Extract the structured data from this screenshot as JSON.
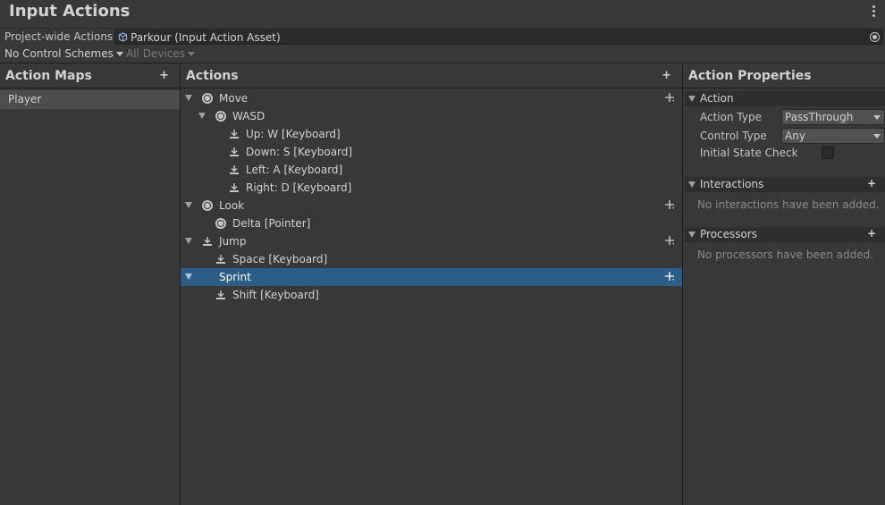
{
  "window": {
    "title": "Input Actions"
  },
  "asset": {
    "label": "Project-wide Actions",
    "value": "Parkour (Input Action Asset)"
  },
  "toolbar": {
    "scheme": "No Control Schemes",
    "devices": "All Devices"
  },
  "maps_panel": {
    "title": "Action Maps",
    "add": "+",
    "items": [
      {
        "label": "Player",
        "selected": true
      }
    ]
  },
  "actions_panel": {
    "title": "Actions",
    "add": "+",
    "rows": [
      {
        "label": "Move",
        "kind": "action",
        "icon": "value-action-icon"
      },
      {
        "label": "WASD",
        "kind": "composite",
        "icon": "value-action-icon"
      },
      {
        "label": "Up: W [Keyboard]",
        "kind": "part",
        "icon": "binding-icon"
      },
      {
        "label": "Down: S [Keyboard]",
        "kind": "part",
        "icon": "binding-icon"
      },
      {
        "label": "Left: A [Keyboard]",
        "kind": "part",
        "icon": "binding-icon"
      },
      {
        "label": "Right: D [Keyboard]",
        "kind": "part",
        "icon": "binding-icon"
      },
      {
        "label": "Look",
        "kind": "action",
        "icon": "value-action-icon"
      },
      {
        "label": "Delta [Pointer]",
        "kind": "binding",
        "icon": "value-action-icon"
      },
      {
        "label": "Jump",
        "kind": "action",
        "icon": "button-action-icon"
      },
      {
        "label": "Space [Keyboard]",
        "kind": "binding",
        "icon": "binding-icon"
      },
      {
        "label": "Sprint",
        "kind": "action",
        "icon": "none",
        "selected": true
      },
      {
        "label": "Shift [Keyboard]",
        "kind": "binding",
        "icon": "binding-icon"
      }
    ]
  },
  "properties_panel": {
    "title": "Action Properties",
    "action_section": "Action",
    "action_type_label": "Action Type",
    "action_type_value": "PassThrough",
    "control_type_label": "Control Type",
    "control_type_value": "Any",
    "initial_state_label": "Initial State Check",
    "initial_state_checked": false,
    "interactions_section": "Interactions",
    "interactions_empty": "No interactions have been added.",
    "processors_section": "Processors",
    "processors_empty": "No processors have been added.",
    "add": "+"
  },
  "colors": {
    "background": "#383838",
    "selection": "#2c5d87",
    "header": "#2e2e2e"
  }
}
